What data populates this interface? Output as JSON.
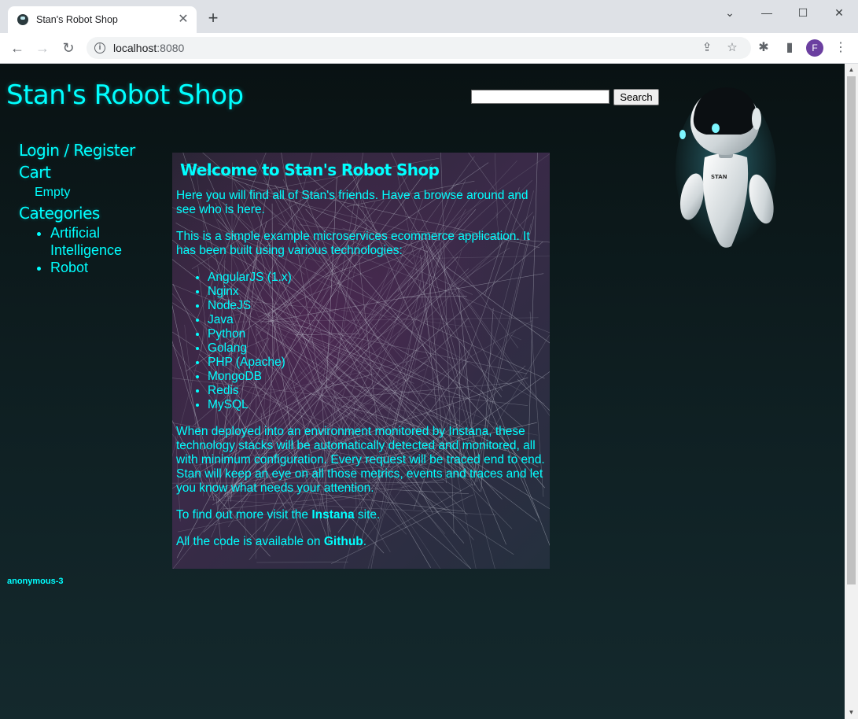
{
  "browser": {
    "tab_title": "Stan's Robot Shop",
    "url_host": "localhost",
    "url_port": ":8080",
    "profile_initial": "F"
  },
  "page": {
    "site_title": "Stan's Robot Shop",
    "search": {
      "value": "",
      "button_label": "Search"
    },
    "sidebar": {
      "login_label": "Login / Register",
      "cart_label": "Cart",
      "cart_status": "Empty",
      "categories_label": "Categories",
      "categories": [
        "Artificial Intelligence",
        "Robot"
      ]
    },
    "welcome": {
      "heading": "Welcome to Stan's Robot Shop",
      "intro": "Here you will find all of Stan's friends. Have a browse around and see who is here.",
      "about": "This is a simple example microservices ecommerce application. It has been built using various technologies:",
      "technologies": [
        "AngularJS (1.x)",
        "Nginx",
        "NodeJS",
        "Java",
        "Python",
        "Golang",
        "PHP (Apache)",
        "MongoDB",
        "Redis",
        "MySQL"
      ],
      "monitoring": "When deployed into an environment monitored by Instana, these technology stacks will be automatically detected and monitored, all with minimum configuration. Every request will be traced end to end. Stan will keep an eye on all those metrics, events and traces and let you know what needs your attention.",
      "more_prefix": "To find out more visit the ",
      "more_link": "Instana",
      "more_suffix": " site.",
      "code_prefix": "All the code is available on ",
      "code_link": "Github",
      "code_suffix": "."
    },
    "user": "anonymous-3",
    "robot_badge": "STAN"
  },
  "colors": {
    "accent": "#00ffff",
    "background": "#0d1a1c"
  }
}
